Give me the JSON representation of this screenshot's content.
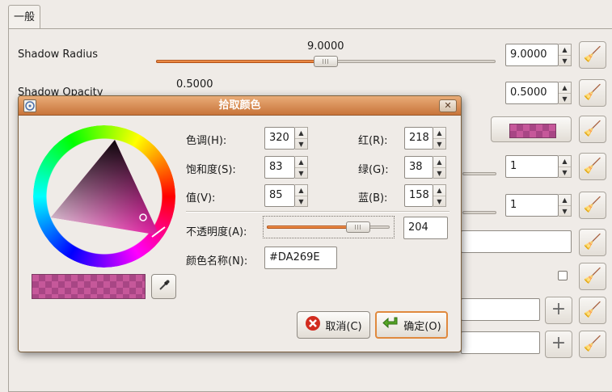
{
  "notebook": {
    "tab_label": "一般"
  },
  "settings": {
    "rows": [
      {
        "label": "Shadow Radius",
        "slider_value_text": "9.0000",
        "spin_value": "9.0000",
        "fraction": 0.5
      },
      {
        "label": "Shadow Opacity",
        "slider_value_text": "0.5000",
        "spin_value": "0.5000",
        "fraction": 0.05
      }
    ],
    "spin_values_behind_dialog": [
      "1",
      "1"
    ]
  },
  "dialog": {
    "title": "拾取颜色",
    "close_glyph": "✕",
    "fields": {
      "hue": {
        "label": "色调(H):",
        "value": "320"
      },
      "saturation": {
        "label": "饱和度(S):",
        "value": "83"
      },
      "value": {
        "label": "值(V):",
        "value": "85"
      },
      "red": {
        "label": "红(R):",
        "value": "218"
      },
      "green": {
        "label": "绿(G):",
        "value": "38"
      },
      "blue": {
        "label": "蓝(B):",
        "value": "158"
      },
      "opacity": {
        "label": "不透明度(A):",
        "value": "204",
        "fraction": 0.8
      },
      "color_name": {
        "label": "颜色名称(N):",
        "value": "#DA269E"
      }
    },
    "cancel_label": "取消(C)",
    "ok_label": "确定(O)"
  },
  "colors": {
    "selected": "#DA269E",
    "accent": "#e0893e",
    "titlebar": "#d98c52"
  },
  "icons": [
    "picker-dialog-icon",
    "close-icon",
    "eyedropper-icon",
    "broom-icon",
    "plus-icon",
    "cancel-icon",
    "ok-arrow-icon"
  ]
}
